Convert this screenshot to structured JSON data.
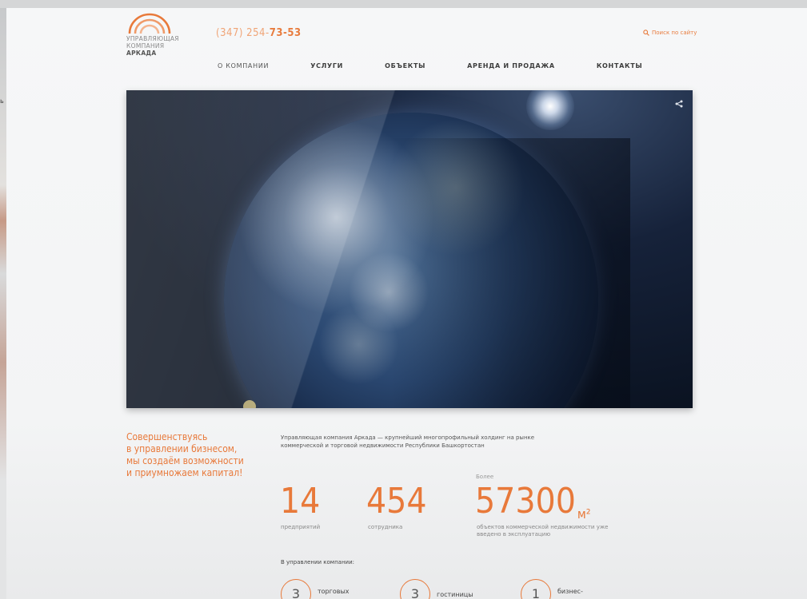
{
  "left_strip": {
    "text": "ь"
  },
  "header": {
    "logo": {
      "line1": "УПРАВЛЯЮЩАЯ",
      "line2": "КОМПАНИЯ",
      "line3": "АРКАДА"
    },
    "phone": {
      "prefix": "(347) 254-",
      "bold": "73-53"
    },
    "search_label": "Поиск по сайту",
    "nav": [
      "О КОМПАНИИ",
      "УСЛУГИ",
      "ОБЪЕКТЫ",
      "АРЕНДА И ПРОДАЖА",
      "КОНТАКТЫ"
    ]
  },
  "hero": {
    "share_icon": "share-icon"
  },
  "slogan": [
    "Совершенствуясь",
    "в управлении бизнесом,",
    "мы создаём возможности",
    "и приумножаем капитал!"
  ],
  "about": "Управляющая компания Аркада — крупнейший многопрофильный холдинг на рынке коммерческой и торговой недвижимости Республики Башкортостан",
  "stats": {
    "prefix": "Более",
    "items": [
      {
        "value": "14",
        "label": "предприятий"
      },
      {
        "value": "454",
        "label": "сотрудника"
      },
      {
        "value": "57300",
        "unit": "м²",
        "label": "объектов коммерческой недвижимости уже введено в эксплуатацию"
      }
    ]
  },
  "managed": {
    "title": "В управлении компании:",
    "items": [
      {
        "count": "3",
        "label": "торговых"
      },
      {
        "count": "3",
        "label": "гостиницы"
      },
      {
        "count": "1",
        "label": "бизнес-"
      }
    ]
  },
  "colors": {
    "accent": "#e8793a",
    "accent_light": "#f0a476"
  }
}
